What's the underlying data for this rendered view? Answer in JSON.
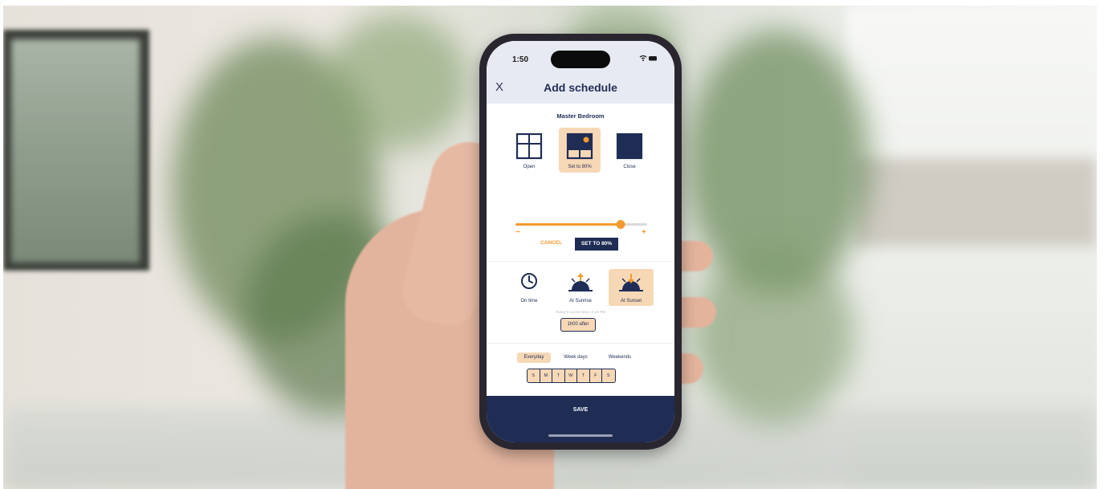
{
  "status_bar": {
    "time": "1:50",
    "icons": "wifi-battery"
  },
  "header": {
    "close_label": "X",
    "title": "Add schedule"
  },
  "room": {
    "name": "Master Bedroom"
  },
  "position_options": [
    {
      "label": "Open",
      "icon": "window-open-icon",
      "selected": false
    },
    {
      "label": "Set to 80%",
      "icon": "shade-partial-icon",
      "selected": true
    },
    {
      "label": "Close",
      "icon": "shade-closed-icon",
      "selected": false
    }
  ],
  "slider": {
    "level_percent": 80,
    "minus_label": "−",
    "plus_label": "+"
  },
  "actions": {
    "cancel_label": "CANCEL",
    "set_label": "SET TO 80%"
  },
  "time_options": [
    {
      "label": "On time",
      "icon": "clock-icon",
      "selected": false
    },
    {
      "label": "At Sunrise",
      "icon": "sunrise-icon",
      "selected": false
    },
    {
      "label": "At Sunset",
      "icon": "sunset-icon",
      "selected": true
    }
  ],
  "sunset_hint": "Today's sunset time: 6:24 PM",
  "offset_label": "1h00 after",
  "repeat_tabs": [
    {
      "label": "Everyday",
      "selected": true
    },
    {
      "label": "Week days",
      "selected": false
    },
    {
      "label": "Weekends",
      "selected": false
    }
  ],
  "days": [
    "S",
    "M",
    "T",
    "W",
    "T",
    "F",
    "S"
  ],
  "footer": {
    "save_label": "SAVE"
  },
  "colors": {
    "navy": "#1f2d55",
    "accent": "#f29a2e",
    "highlight": "#f7d8b6"
  }
}
